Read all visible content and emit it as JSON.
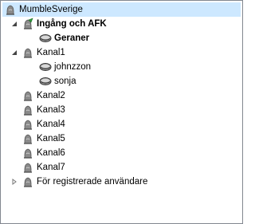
{
  "server": {
    "name": "MumbleSverige",
    "icon": "server-icon"
  },
  "tree": [
    {
      "type": "channel",
      "name": "Ingång och AFK",
      "bold": true,
      "expander": "expanded",
      "icon": "channel-joined-icon",
      "users": [
        {
          "name": "Geraner",
          "bold": true,
          "icon": "user-talk-icon"
        }
      ]
    },
    {
      "type": "channel",
      "name": "Kanal1",
      "bold": false,
      "expander": "expanded",
      "icon": "channel-icon",
      "users": [
        {
          "name": "johnzzon",
          "bold": false,
          "icon": "user-talk-icon"
        },
        {
          "name": "sonja",
          "bold": false,
          "icon": "user-talk-icon"
        }
      ]
    },
    {
      "type": "channel",
      "name": "Kanal2",
      "expander": "none",
      "icon": "channel-icon"
    },
    {
      "type": "channel",
      "name": "Kanal3",
      "expander": "none",
      "icon": "channel-icon"
    },
    {
      "type": "channel",
      "name": "Kanal4",
      "expander": "none",
      "icon": "channel-icon"
    },
    {
      "type": "channel",
      "name": "Kanal5",
      "expander": "none",
      "icon": "channel-icon"
    },
    {
      "type": "channel",
      "name": "Kanal6",
      "expander": "none",
      "icon": "channel-icon"
    },
    {
      "type": "channel",
      "name": "Kanal7",
      "expander": "none",
      "icon": "channel-icon"
    },
    {
      "type": "channel",
      "name": "För registrerade användare",
      "expander": "collapsed",
      "icon": "channel-icon"
    }
  ]
}
